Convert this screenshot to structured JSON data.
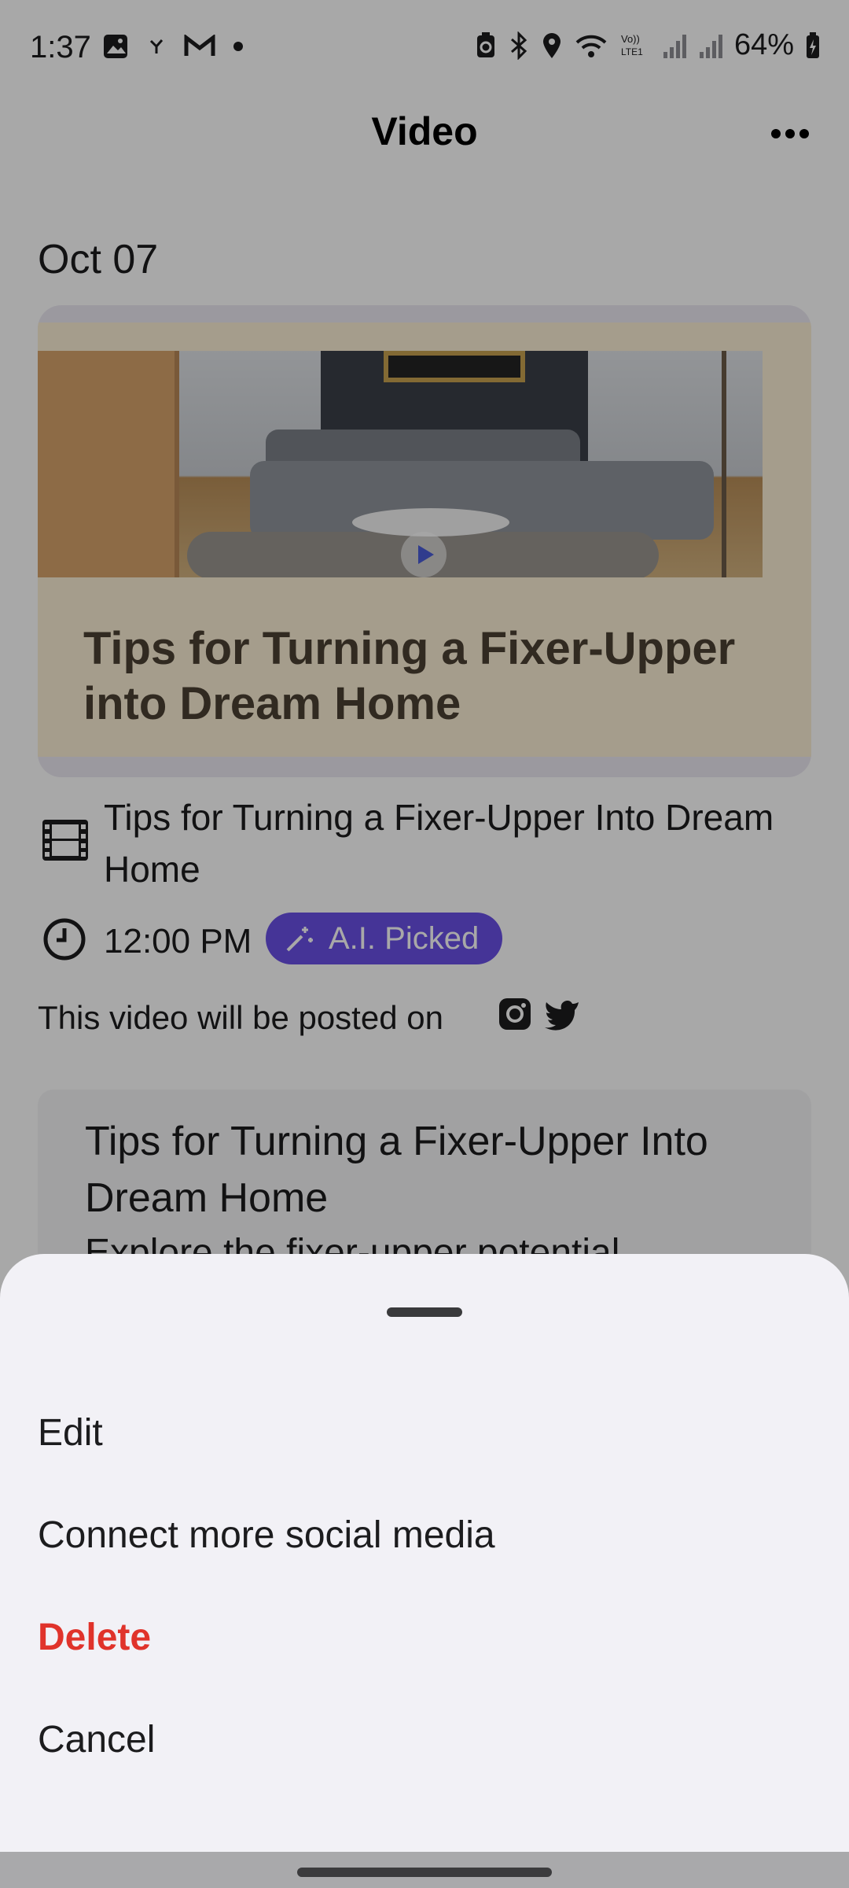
{
  "status_bar": {
    "time": "1:37",
    "battery": "64%",
    "icons": [
      "photo-icon",
      "fan-icon",
      "gmail-icon",
      "dot-icon",
      "battery-saver-icon",
      "bluetooth-icon",
      "location-icon",
      "wifi-icon",
      "volte-icon",
      "signal-icon",
      "signal-icon-2",
      "battery-icon"
    ]
  },
  "header": {
    "title": "Video",
    "more_icon": "more-horizontal-icon"
  },
  "feed": {
    "date": "Oct 07",
    "thumbnail": {
      "title_line1": "Tips for Turning a Fixer-Upper",
      "title_line2_prefix": "into ",
      "title_line2_bold": "Dream Home",
      "play_icon": "play-icon"
    },
    "video_title": "Tips for Turning a Fixer-Upper Into Dream Home",
    "video_icon": "film-icon",
    "time": "12:00 PM",
    "clock_icon": "clock-icon",
    "badge": "A.I. Picked",
    "badge_icon": "magic-wand-icon",
    "posted_text": "This video will be posted on",
    "platform_icons": [
      "instagram-icon",
      "twitter-icon"
    ],
    "description": {
      "title": "Tips for Turning a Fixer-Upper Into Dream Home",
      "body_fragment": "Explore the fixer-upper potential"
    }
  },
  "sheet": {
    "items": [
      {
        "label": "Edit"
      },
      {
        "label": "Connect more social media"
      },
      {
        "label": "Delete"
      },
      {
        "label": "Cancel"
      }
    ]
  },
  "colors": {
    "accent": "#6a50e6",
    "danger": "#e0332b",
    "sheet_bg": "#f2f1f6"
  }
}
